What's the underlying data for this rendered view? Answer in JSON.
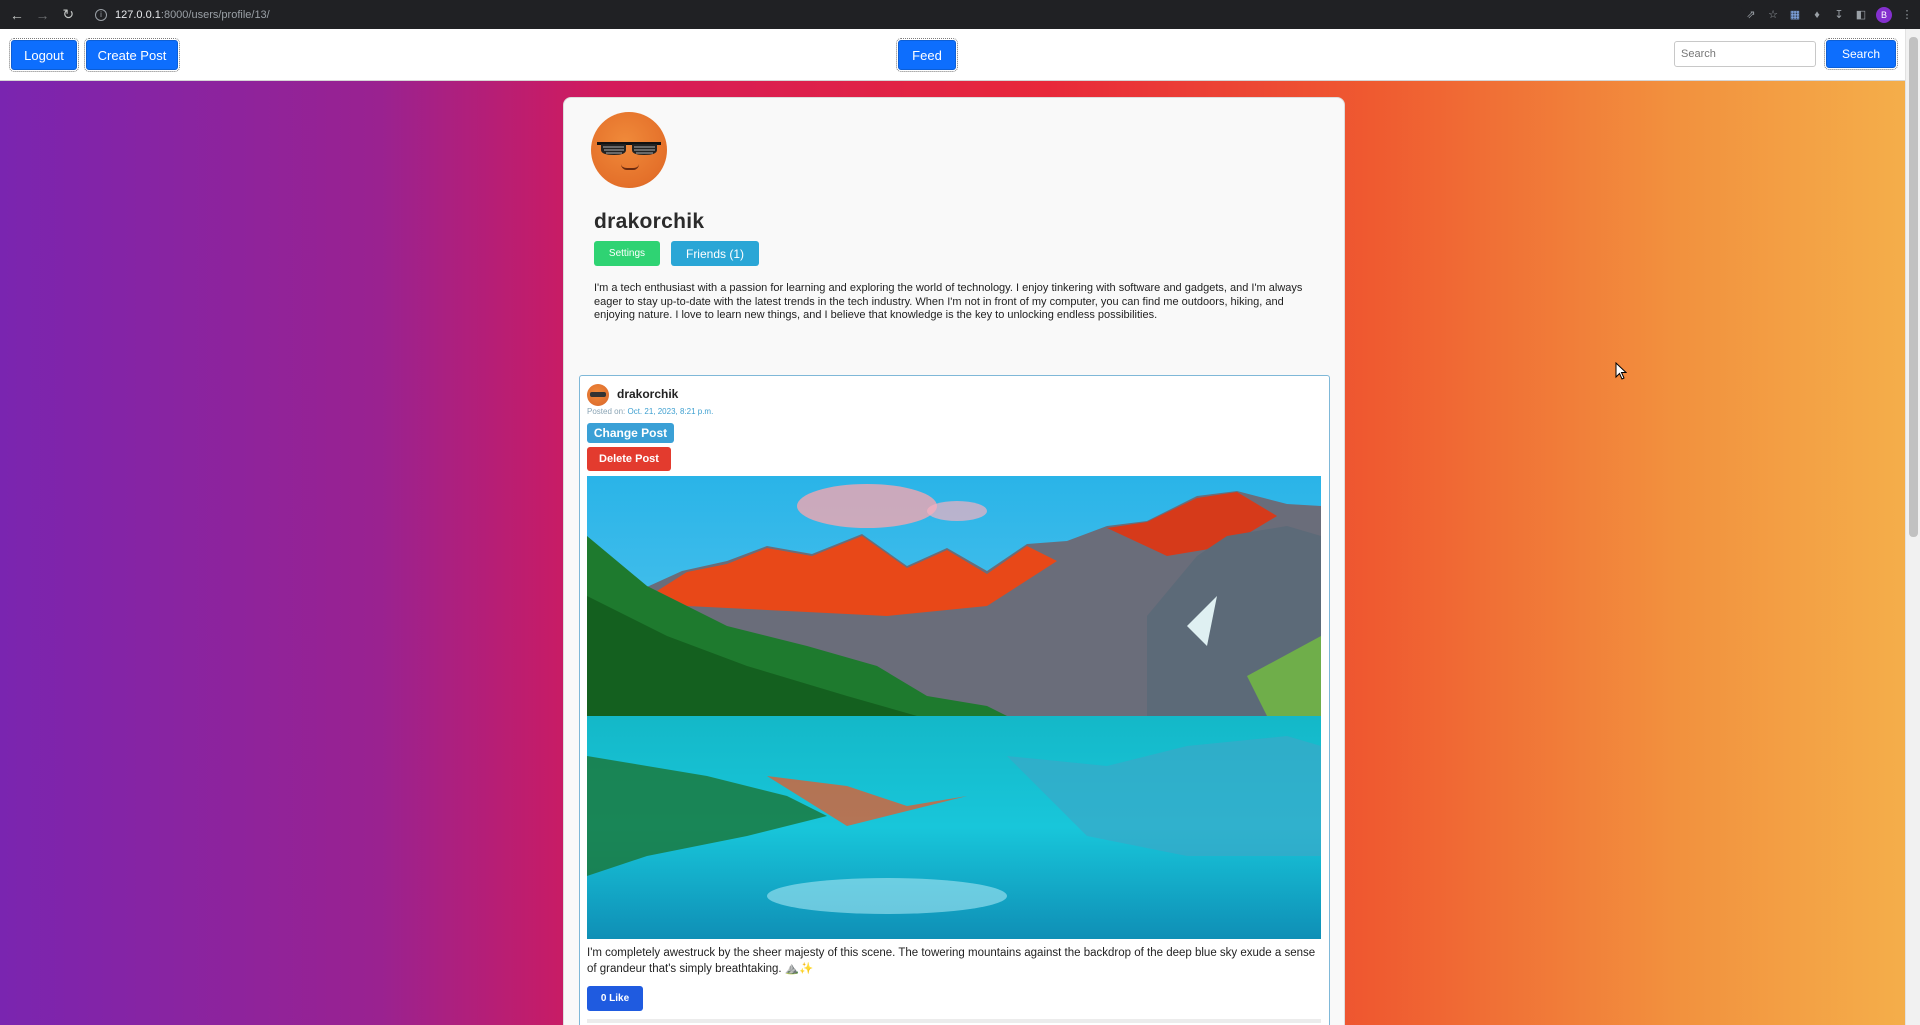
{
  "browser": {
    "url_host": "127.0.0.1",
    "url_path": ":8000/users/profile/13/",
    "profile_initial": "B"
  },
  "navbar": {
    "logout_label": "Logout",
    "create_post_label": "Create Post",
    "feed_label": "Feed",
    "search_placeholder": "Search",
    "search_button_label": "Search"
  },
  "profile": {
    "username": "drakorchik",
    "settings_label": "Settings",
    "friends_label": "Friends (1)",
    "bio": "I'm a tech enthusiast with a passion for learning and exploring the world of technology. I enjoy tinkering with software and gadgets, and I'm always eager to stay up-to-date with the latest trends in the tech industry. When I'm not in front of my computer, you can find me outdoors, hiking, and enjoying nature. I love to learn new things, and I believe that knowledge is the key to unlocking endless possibilities."
  },
  "post": {
    "author": "drakorchik",
    "posted_label": "Posted on:",
    "posted_date": "Oct. 21, 2023, 8:21 p.m.",
    "change_label": "Change Post",
    "delete_label": "Delete Post",
    "text": "I'm completely awestruck by the sheer majesty of this scene. The towering mountains against the backdrop of the deep blue sky exude a sense of grandeur that's simply breathtaking. ⛰️✨",
    "like_label": "0 Like"
  },
  "colors": {
    "primary": "#0d6efd",
    "settings_green": "#2fd373",
    "friends_blue": "#2aa6d6",
    "delete_red": "#e33b2e",
    "like_blue": "#1f5be0"
  }
}
